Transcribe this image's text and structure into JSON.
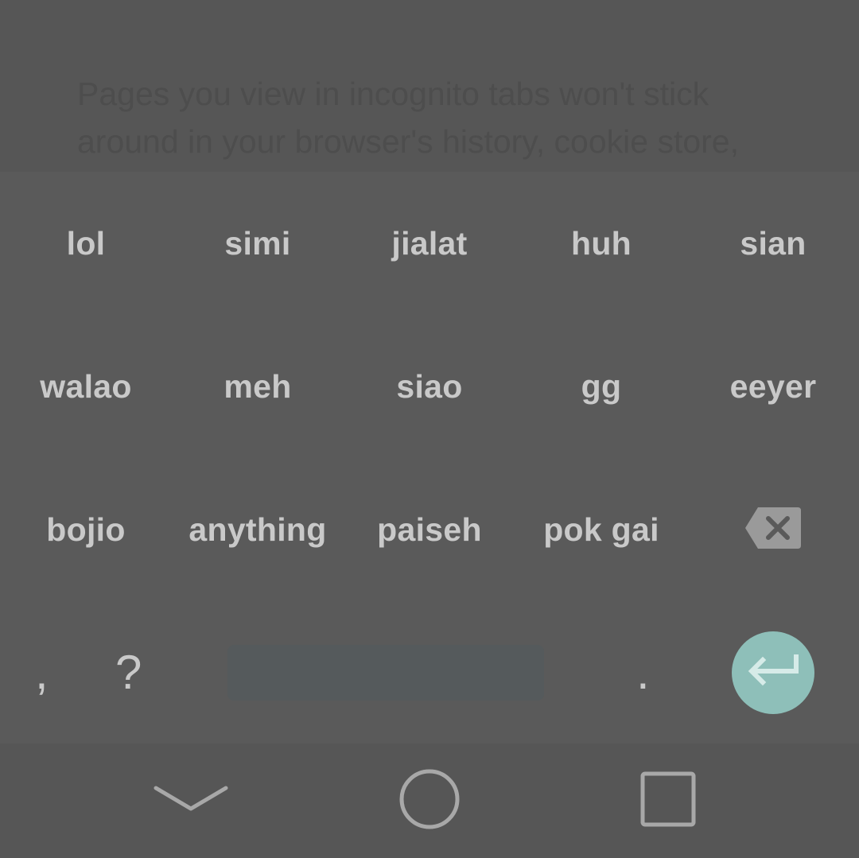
{
  "background_page": {
    "text": "Pages you view in incognito tabs won't stick around in your browser's history, cookie store,"
  },
  "keyboard": {
    "word_rows": [
      [
        "lol",
        "simi",
        "jialat",
        "huh",
        "sian"
      ],
      [
        "walao",
        "meh",
        "siao",
        "gg",
        "eeyer"
      ],
      [
        "bojio",
        "anything",
        "paiseh",
        "pok gai"
      ]
    ],
    "comma": ",",
    "question": "?",
    "period": ".",
    "backspace_icon": "backspace-icon",
    "enter_icon": "enter-arrow-icon",
    "enter_color": "#8ebfb9",
    "text_color": "#c9c9c9"
  },
  "navbar": {
    "back_icon": "chevron-down-icon",
    "home_icon": "circle-home-icon",
    "recents_icon": "square-recents-icon"
  }
}
